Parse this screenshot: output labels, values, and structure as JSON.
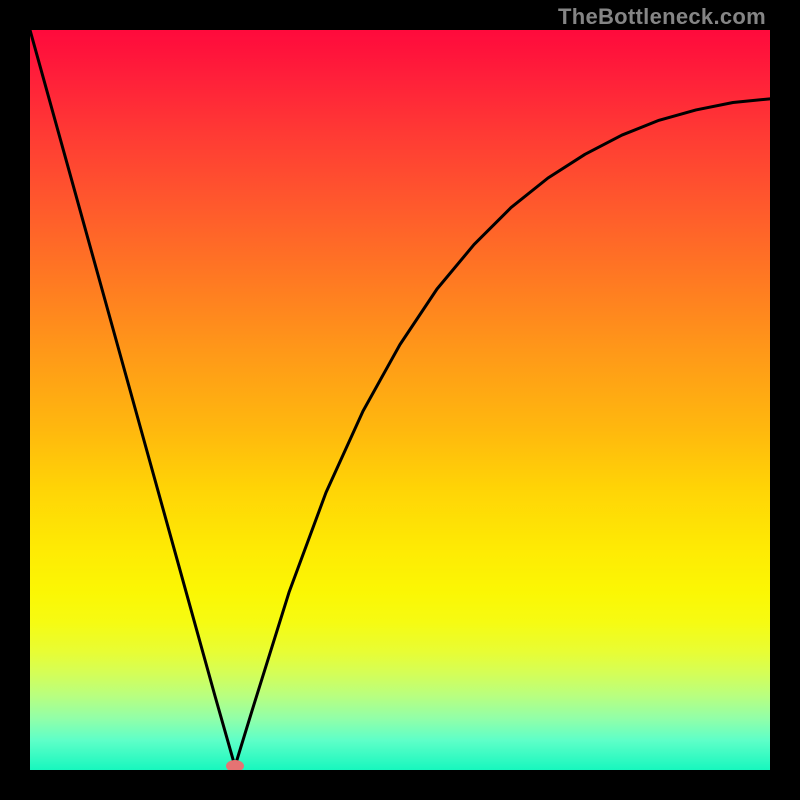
{
  "watermark": "TheBottleneck.com",
  "chart_data": {
    "type": "line",
    "title": "",
    "xlabel": "",
    "ylabel": "",
    "xlim": [
      0,
      100
    ],
    "ylim": [
      0,
      100
    ],
    "grid": false,
    "legend": false,
    "series": [
      {
        "name": "bottleneck-curve",
        "x": [
          0,
          5,
          10,
          15,
          20,
          25,
          27.7,
          30,
          35,
          40,
          45,
          50,
          55,
          60,
          65,
          70,
          75,
          80,
          85,
          90,
          95,
          100
        ],
        "values": [
          100,
          82,
          64,
          46,
          28,
          10,
          0.5,
          8,
          24,
          37.5,
          48.5,
          57.5,
          65,
          71,
          76,
          80,
          83.2,
          85.8,
          87.8,
          89.2,
          90.2,
          90.7
        ]
      }
    ],
    "marker": {
      "x": 27.7,
      "y": 0.5,
      "color": "#e57373"
    },
    "background_gradient": {
      "top": "#ff0a3c",
      "mid": "#ffd406",
      "bottom": "#17f7be"
    }
  },
  "colors": {
    "frame": "#000000",
    "curve": "#000000",
    "marker": "#e57373",
    "watermark": "#858585"
  }
}
